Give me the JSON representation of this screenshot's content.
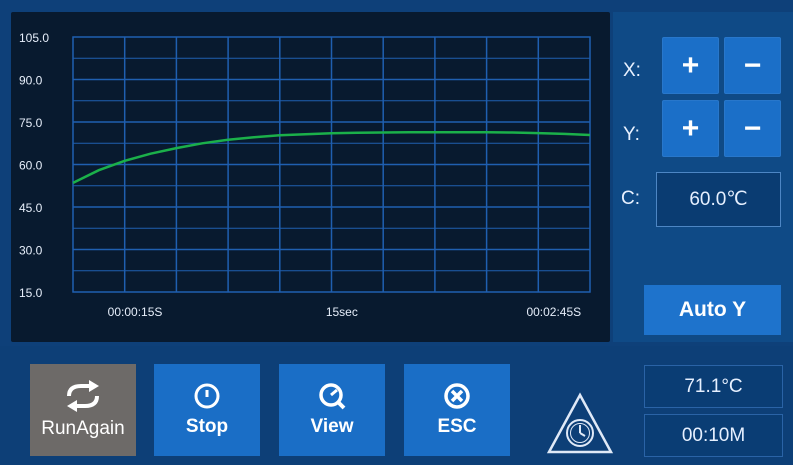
{
  "chart_data": {
    "type": "line",
    "y_ticks": [
      "105.0",
      "90.0",
      "75.0",
      "60.0",
      "45.0",
      "30.0",
      "15.0"
    ],
    "ylim": [
      15,
      105
    ],
    "x_tick_labels": [
      "00:00:15S",
      "15sec",
      "00:02:45S"
    ],
    "grid": true,
    "series": [
      {
        "color": "#1bb04a",
        "x": [
          0,
          0.05,
          0.1,
          0.15,
          0.2,
          0.25,
          0.3,
          0.35,
          0.4,
          0.45,
          0.5,
          0.55,
          0.6,
          0.65,
          0.7,
          0.75,
          0.8,
          0.85,
          0.9,
          0.95,
          1.0
        ],
        "values": [
          53.5,
          58.0,
          61.3,
          63.8,
          65.8,
          67.5,
          68.7,
          69.6,
          70.3,
          70.7,
          71.0,
          71.2,
          71.3,
          71.4,
          71.4,
          71.4,
          71.4,
          71.3,
          71.1,
          70.8,
          70.4
        ]
      }
    ]
  },
  "controls": {
    "x_label": "X:",
    "y_label": "Y:",
    "c_label": "C:",
    "plus_glyph": "+",
    "minus_glyph": "−",
    "c_value": "60.0℃",
    "auto_y_label": "Auto Y"
  },
  "toolbar": {
    "run_again_label": "RunAgain",
    "stop_label": "Stop",
    "view_label": "View",
    "esc_label": "ESC"
  },
  "status": {
    "temperature": "71.1°C",
    "time": "00:10M"
  },
  "colors": {
    "accent": "#1b6fc8",
    "chart_bg": "#081a2f",
    "grid": "#1f5fb0",
    "line": "#1bb04a"
  }
}
